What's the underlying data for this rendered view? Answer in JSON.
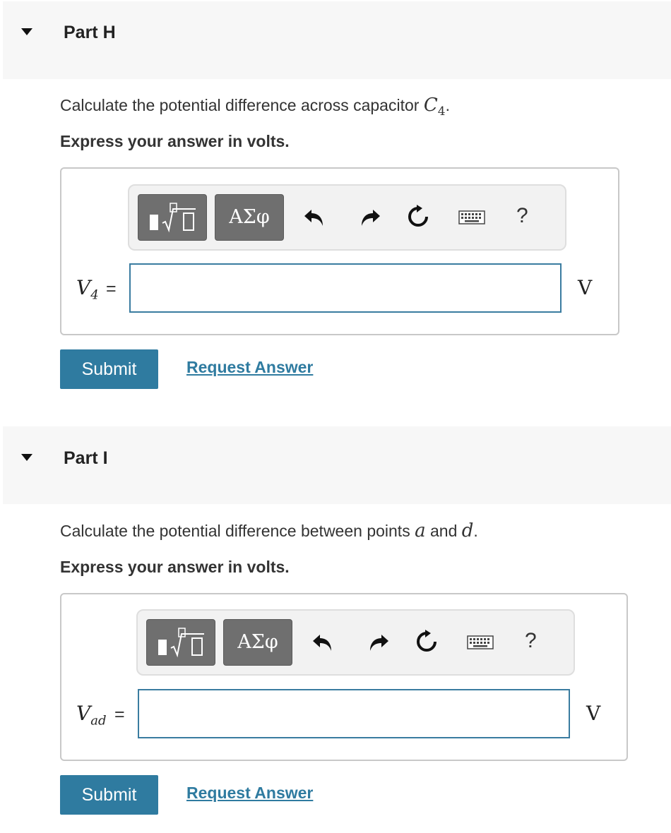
{
  "parts": [
    {
      "title": "Part H",
      "question_prefix": "Calculate the potential difference across capacitor ",
      "question_var": "C",
      "question_var_sub": "4",
      "question_suffix": ".",
      "instruction": "Express your answer in volts.",
      "greek_label": "ΑΣφ",
      "help_label": "?",
      "var_label": "V",
      "var_sub": "4",
      "equals": "=",
      "input_value": "",
      "unit": "V",
      "submit_label": "Submit",
      "request_label": "Request Answer"
    },
    {
      "title": "Part I",
      "question_prefix": "Calculate the potential difference between points ",
      "question_var": "a",
      "question_mid": " and ",
      "question_var2": "d",
      "question_suffix": ".",
      "instruction": "Express your answer in volts.",
      "greek_label": "ΑΣφ",
      "help_label": "?",
      "var_label": "V",
      "var_sub": "ad",
      "equals": "=",
      "input_value": "",
      "unit": "V",
      "submit_label": "Submit",
      "request_label": "Request Answer"
    }
  ],
  "icons": [
    "caret-down-icon",
    "templates-icon",
    "undo-icon",
    "redo-icon",
    "reset-icon",
    "keyboard-icon",
    "help-icon"
  ],
  "colors": {
    "accent": "#2f7ba0",
    "header_bg": "#f7f7f7",
    "toolbar_btn": "#6f6f6f"
  }
}
